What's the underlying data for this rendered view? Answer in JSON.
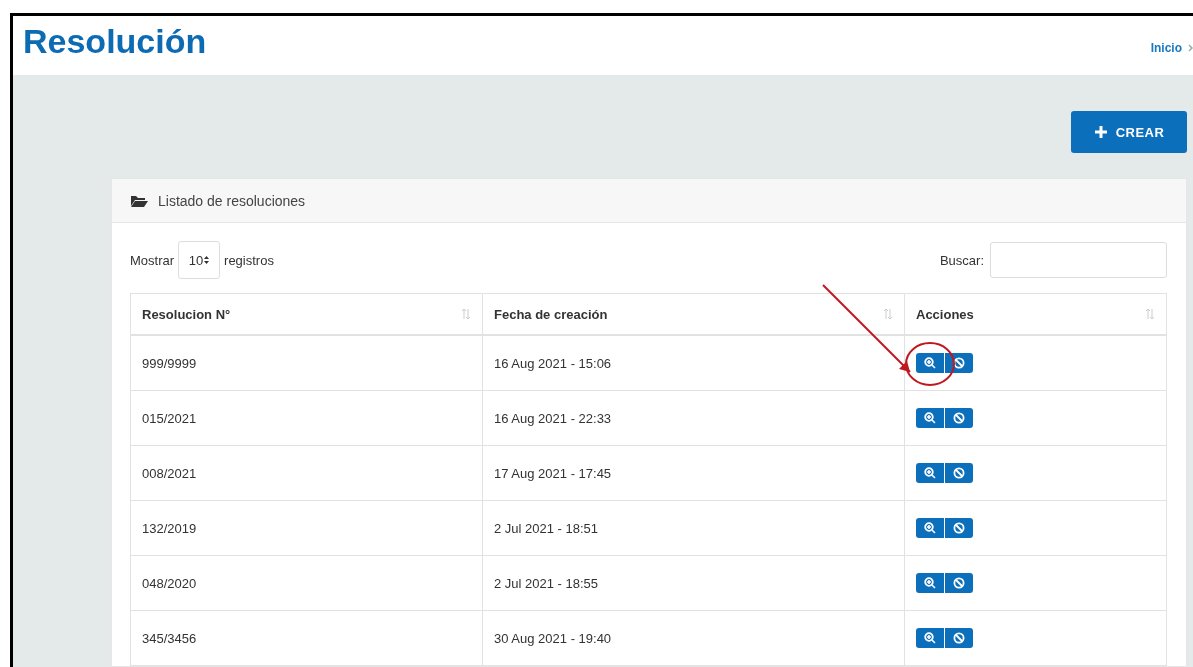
{
  "page": {
    "title": "Resolución",
    "breadcrumb": [
      {
        "label": "Inicio"
      }
    ]
  },
  "create_button": {
    "label": "CREAR"
  },
  "card": {
    "title": "Listado de resoluciones",
    "length": {
      "before": "Mostrar",
      "value": "10",
      "after": "registros"
    },
    "search": {
      "label": "Buscar:"
    },
    "table": {
      "columns": [
        "Resolucion N°",
        "Fecha de creación",
        "Acciones"
      ],
      "rows": [
        {
          "number": "999/9999",
          "date": "16 Aug 2021 - 15:06",
          "highlighted": true
        },
        {
          "number": "015/2021",
          "date": "16 Aug 2021 - 22:33",
          "highlighted": false
        },
        {
          "number": "008/2021",
          "date": "17 Aug 2021 - 17:45",
          "highlighted": false
        },
        {
          "number": "132/2019",
          "date": "2 Jul 2021 - 18:51",
          "highlighted": false
        },
        {
          "number": "048/2020",
          "date": "2 Jul 2021 - 18:55",
          "highlighted": false
        },
        {
          "number": "345/3456",
          "date": "30 Aug 2021 - 19:40",
          "highlighted": false
        }
      ]
    }
  }
}
